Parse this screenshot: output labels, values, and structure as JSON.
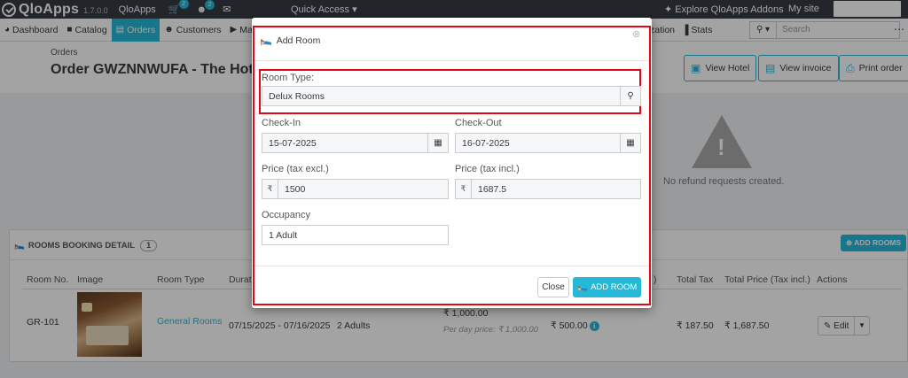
{
  "topbar": {
    "logo_text": "QloApps",
    "version": "1.7.0.0",
    "site_name": "QloApps",
    "cart_badge": "2",
    "user_badge": "2",
    "quick_access": "Quick Access ▾",
    "explore": "Explore QloApps Addons",
    "my_site": "My site"
  },
  "nav": {
    "items": [
      {
        "icon": "◕",
        "label": "Dashboard"
      },
      {
        "icon": "■",
        "label": "Catalog"
      },
      {
        "icon": "▤",
        "label": "Orders"
      },
      {
        "icon": "☻",
        "label": "Customers"
      },
      {
        "icon": "▶",
        "label": "Ma"
      }
    ],
    "partial": "zation",
    "stats_icon": "▐",
    "stats": "Stats",
    "search_placeholder": "Search",
    "search_btn": "⚲ ▾"
  },
  "header": {
    "breadcrumb": "Orders",
    "title": "Order GWZNNWUFA - The Hotel P",
    "view_hotel": "View Hotel",
    "view_invoice": "View invoice",
    "print_order": "Print order"
  },
  "refund": {
    "text": "No refund requests created."
  },
  "rooms": {
    "title": "ROOMS BOOKING DETAIL",
    "count": "1",
    "add_rooms": "⊕ ADD ROOMS",
    "columns": {
      "room_no": "Room No.",
      "image": "Image",
      "room_type": "Room Type",
      "duration": "Durat",
      "tax_partial": ")",
      "total_tax": "Total Tax",
      "total_price": "Total Price (Tax incl.)",
      "actions": "Actions"
    },
    "row": {
      "room_no": "GR-101",
      "room_type": "General Rooms",
      "dates": "07/15/2025 - 07/16/2025",
      "occupancy": "2 Adults",
      "price": "₹ 1,000.00",
      "per_day": "Per day price: ₹ 1,000.00",
      "extra": "₹ 500.00",
      "total_tax": "₹ 187.50",
      "total_price": "₹ 1,687.50",
      "edit": "✎ Edit"
    }
  },
  "modal": {
    "title": "Add Room",
    "room_type_label": "Room Type:",
    "room_type_value": "Delux Rooms",
    "checkin_label": "Check-In",
    "checkin_value": "15-07-2025",
    "checkout_label": "Check-Out",
    "checkout_value": "16-07-2025",
    "price_excl_label": "Price (tax excl.)",
    "price_excl_value": "1500",
    "price_incl_label": "Price (tax incl.)",
    "price_incl_value": "1687.5",
    "currency_symbol": "₹",
    "occupancy_label": "Occupancy",
    "occupancy_value": "1 Adult",
    "close_label": "Close",
    "add_room_label": "ADD ROOM"
  },
  "colors": {
    "accent": "#25b9d7",
    "highlight": "#e30613",
    "topbar": "#363a41"
  }
}
